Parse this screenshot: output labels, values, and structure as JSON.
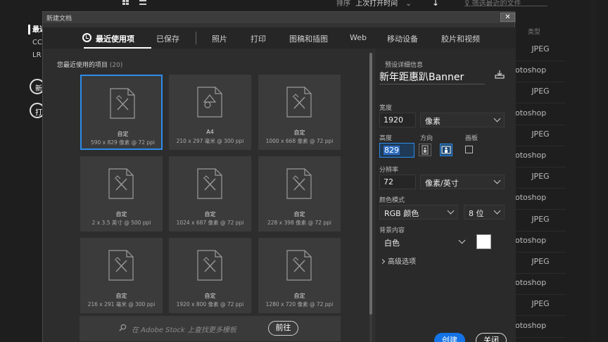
{
  "background": {
    "sort_label": "排序",
    "sort_value": "上次打开时间",
    "filter_placeholder": "筛选最近的文件",
    "nav": [
      "最近",
      "CC",
      "LR"
    ],
    "pill_buttons": [
      "新",
      "打"
    ],
    "type_header": "类型",
    "file_types": [
      "JPEG",
      "otoshop",
      "JPEG",
      "otoshop",
      "JPEG",
      "otoshop",
      "JPEG",
      "otoshop",
      "JPEG",
      "otoshop",
      "JPEG",
      "otoshop",
      "JPEG",
      "otoshop"
    ]
  },
  "dialog": {
    "title": "新建文档",
    "close_glyph": "✕",
    "tabs": [
      "最近使用项",
      "已保存",
      "照片",
      "打印",
      "图稿和插图",
      "Web",
      "移动设备",
      "胶片和视频"
    ],
    "recent_title": "您最近使用的项目",
    "recent_count": "(20)",
    "presets": [
      {
        "name": "自定",
        "size": "590 x 829 像素 @ 72 ppi"
      },
      {
        "name": "A4",
        "size": "210 x 297 毫米 @ 300 ppi"
      },
      {
        "name": "自定",
        "size": "1000 x 668 像素 @ 72 ppi"
      },
      {
        "name": "自定",
        "size": "2 x 3.5 英寸 @ 500 ppi"
      },
      {
        "name": "自定",
        "size": "1024 x 687 像素 @ 72 ppi"
      },
      {
        "name": "自定",
        "size": "228 x 398 像素 @ 72 ppi"
      },
      {
        "name": "自定",
        "size": "216 x 291 毫米 @ 300 ppi"
      },
      {
        "name": "自定",
        "size": "1920 x 800 像素 @ 72 ppi"
      },
      {
        "name": "自定",
        "size": "1280 x 720 像素 @ 72 ppi"
      }
    ],
    "search_placeholder": "在 Adobe Stock 上查找更多模板",
    "go_label": "前往",
    "details": {
      "heading": "预设详细信息",
      "name": "新年距惠趴Banner",
      "width_label": "宽度",
      "width": "1920",
      "width_unit": "像素",
      "height_label": "高度",
      "height": "829",
      "orientation_label": "方向",
      "artboard_label": "画板",
      "resolution_label": "分辨率",
      "resolution": "72",
      "resolution_unit": "像素/英寸",
      "color_mode_label": "颜色模式",
      "color_mode": "RGB 颜色",
      "bit_depth": "8 位",
      "background_label": "背景内容",
      "background": "白色",
      "advanced": "高级选项",
      "create": "创建",
      "close": "关闭"
    }
  },
  "colors": {
    "accent": "#1473e6",
    "selection": "#2d8ceb"
  }
}
